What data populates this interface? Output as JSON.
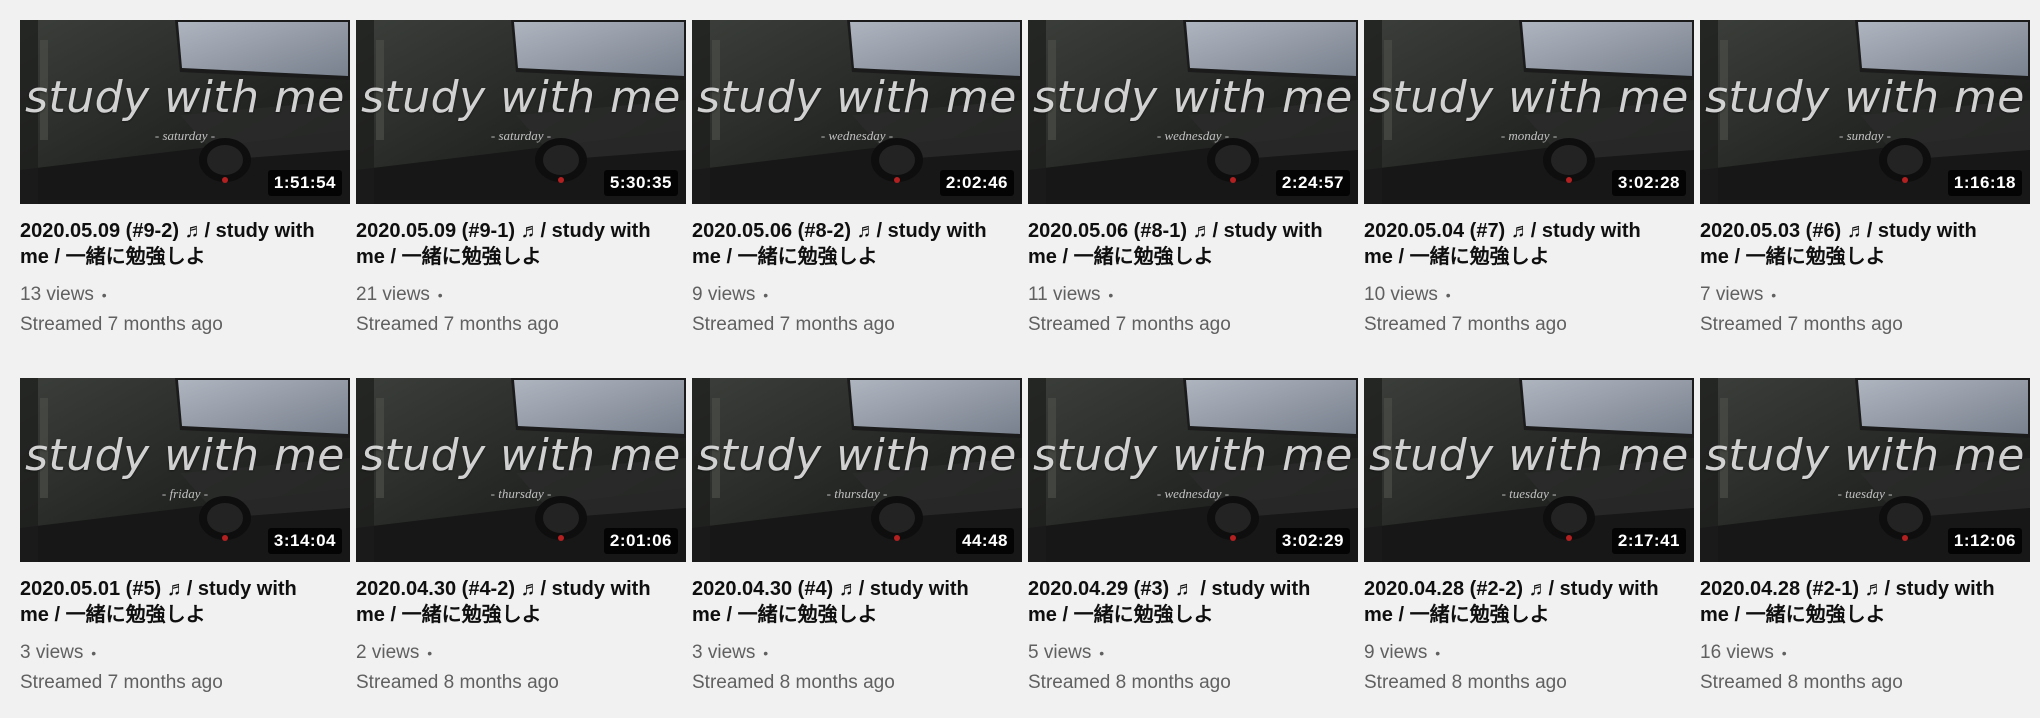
{
  "thumbnail_text": "study with me",
  "videos": [
    {
      "title": "2020.05.09 (#9-2) ♬/ study with me / 一緒に勉強しよ",
      "duration": "1:51:54",
      "day": "- saturday -",
      "views": "13 views",
      "streamed": "Streamed 7 months ago"
    },
    {
      "title": "2020.05.09 (#9-1) ♬/ study with me / 一緒に勉強しよ",
      "duration": "5:30:35",
      "day": "- saturday -",
      "views": "21 views",
      "streamed": "Streamed 7 months ago"
    },
    {
      "title": "2020.05.06 (#8-2) ♬/ study with me / 一緒に勉強しよ",
      "duration": "2:02:46",
      "day": "- wednesday -",
      "views": "9 views",
      "streamed": "Streamed 7 months ago"
    },
    {
      "title": "2020.05.06 (#8-1) ♬/ study with me / 一緒に勉強しよ",
      "duration": "2:24:57",
      "day": "- wednesday -",
      "views": "11 views",
      "streamed": "Streamed 7 months ago"
    },
    {
      "title": "2020.05.04 (#7) ♬/ study with me / 一緒に勉強しよ",
      "duration": "3:02:28",
      "day": "- monday -",
      "views": "10 views",
      "streamed": "Streamed 7 months ago"
    },
    {
      "title": "2020.05.03 (#6) ♬/ study with me / 一緒に勉強しよ",
      "duration": "1:16:18",
      "day": "- sunday -",
      "views": "7 views",
      "streamed": "Streamed 7 months ago"
    },
    {
      "title": "2020.05.01 (#5) ♬/ study with me / 一緒に勉強しよ",
      "duration": "3:14:04",
      "day": "- friday -",
      "views": "3 views",
      "streamed": "Streamed 7 months ago"
    },
    {
      "title": "2020.04.30 (#4-2) ♬/ study with me / 一緒に勉強しよ",
      "duration": "2:01:06",
      "day": "- thursday -",
      "views": "2 views",
      "streamed": "Streamed 8 months ago"
    },
    {
      "title": "2020.04.30 (#4) ♬/ study with me / 一緒に勉強しよ",
      "duration": "44:48",
      "day": "- thursday -",
      "views": "3 views",
      "streamed": "Streamed 8 months ago"
    },
    {
      "title": "2020.04.29 (#3) ♬ / study with me / 一緒に勉強しよ",
      "duration": "3:02:29",
      "day": "- wednesday -",
      "views": "5 views",
      "streamed": "Streamed 8 months ago"
    },
    {
      "title": "2020.04.28 (#2-2) ♬/ study with me / 一緒に勉強しよ",
      "duration": "2:17:41",
      "day": "- tuesday -",
      "views": "9 views",
      "streamed": "Streamed 8 months ago"
    },
    {
      "title": "2020.04.28 (#2-1) ♬/ study with me / 一緒に勉強しよ",
      "duration": "1:12:06",
      "day": "- tuesday -",
      "views": "16 views",
      "streamed": "Streamed 8 months ago"
    }
  ]
}
